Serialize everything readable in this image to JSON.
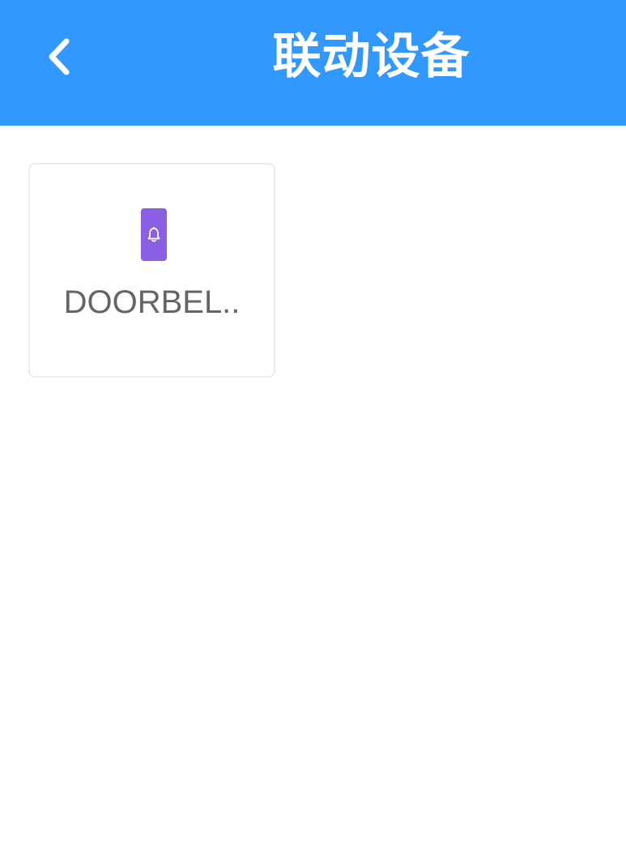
{
  "header": {
    "title": "联动设备",
    "back_icon": "chevron-left-icon",
    "background_color": "#3398fd"
  },
  "devices": [
    {
      "name": "DOORBEL..",
      "icon": "doorbell-icon",
      "icon_color": "#8a5fe3"
    }
  ]
}
